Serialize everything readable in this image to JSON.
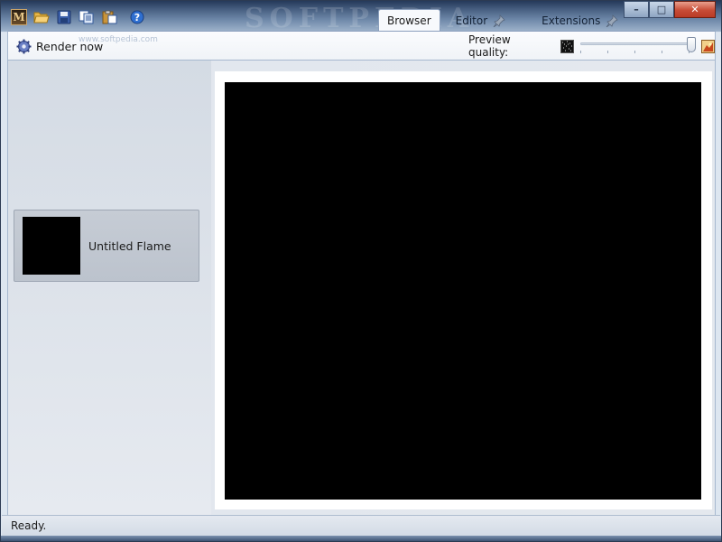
{
  "window": {
    "watermark": "SOFTPEDIA",
    "controls": {
      "minimize": "–",
      "maximize": "□",
      "close": "✕"
    }
  },
  "quick_access": {
    "app_letter": "M",
    "items": [
      "open-folder-icon",
      "save-icon",
      "copy-icon",
      "paste-icon",
      "help-icon"
    ]
  },
  "ribbon": {
    "tabs": [
      {
        "label": "Browser",
        "active": true
      },
      {
        "label": "Editor",
        "active": false,
        "pinned": true
      },
      {
        "label": "Extensions",
        "active": false,
        "pinned": true
      }
    ],
    "render_label": "Render now",
    "faint_text": "www.softpedia.com",
    "preview_quality_label": "Preview quality:",
    "preview_quality": 1.0
  },
  "browser": {
    "flames": [
      {
        "name": "Untitled Flame"
      }
    ]
  },
  "status": {
    "text": "Ready."
  },
  "colors": {
    "accent": "#6d87a8",
    "close_button": "#c74c36",
    "canvas": "#000000"
  }
}
